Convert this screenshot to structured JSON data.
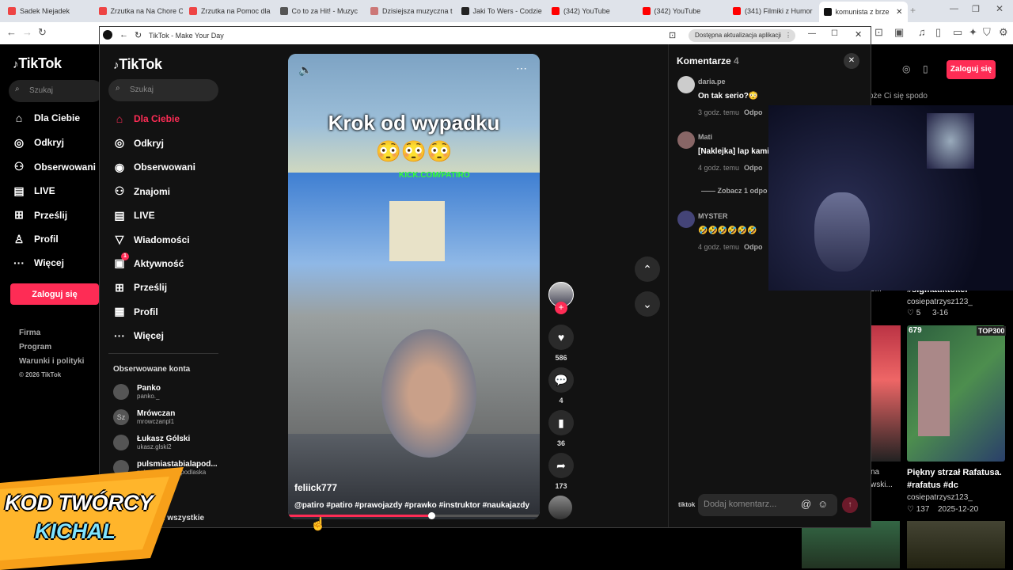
{
  "browser_tabs": [
    {
      "label": "Sadek Niejadek",
      "color": "#e44"
    },
    {
      "label": "Zrzutka na Na Chore C",
      "color": "#e44"
    },
    {
      "label": "Zrzutka na Pomoc dla",
      "color": "#e44"
    },
    {
      "label": "Co to za Hit! - Muzyc",
      "color": "#555"
    },
    {
      "label": "Dzisiejsza muzyczna t",
      "color": "#c77"
    },
    {
      "label": "Jaki To Wers - Codzie",
      "color": "#222"
    },
    {
      "label": "(342) YouTube",
      "color": "#f00"
    },
    {
      "label": "(342) YouTube",
      "color": "#f00"
    },
    {
      "label": "(341) Filmiki z Humor",
      "color": "#f00"
    },
    {
      "label": "komunista z brze",
      "color": "#111"
    }
  ],
  "bg": {
    "logo": "TikTok",
    "search_placeholder": "Szukaj",
    "nav": [
      {
        "icon": "⌂",
        "label": "Dla Ciebie"
      },
      {
        "icon": "◎",
        "label": "Odkryj"
      },
      {
        "icon": "⚇",
        "label": "Obserwowani"
      },
      {
        "icon": "▤",
        "label": "LIVE"
      },
      {
        "icon": "⊞",
        "label": "Prześlij"
      },
      {
        "icon": "♙",
        "label": "Profil"
      },
      {
        "icon": "···",
        "label": "Więcej"
      }
    ],
    "login": "Zaloguj się",
    "footer": [
      "Firma",
      "Program",
      "Warunki i polityki",
      "© 2026 TikTok"
    ],
    "top_login": "Zaloguj się",
    "suggest_text": "oże Ci się spodo",
    "cards": [
      {
        "tag": "#sigmatiktoker",
        "author": "cosiepatrzysz123_",
        "likes": "♡ 5",
        "date": "3-16",
        "partial": "o..."
      },
      {
        "title": "Piękny strzał Rafatusa.",
        "tags": "#rafatus #dc",
        "author": "cosiepatrzysz123_",
        "likes": "♡ 137",
        "date": "2025-12-20",
        "partial_a": "na",
        "partial_b": "wski..."
      }
    ],
    "card_badge": "679",
    "card_badge2": "TOP300"
  },
  "win": {
    "title": "TikTok - Make Your Day",
    "update": "Dostępna aktualizacja aplikacji",
    "logo": "TikTok",
    "search_placeholder": "Szukaj",
    "nav": [
      {
        "icon": "⌂",
        "label": "Dla Ciebie",
        "active": true
      },
      {
        "icon": "◎",
        "label": "Odkryj"
      },
      {
        "icon": "◉",
        "label": "Obserwowani"
      },
      {
        "icon": "⚇",
        "label": "Znajomi"
      },
      {
        "icon": "▤",
        "label": "LIVE"
      },
      {
        "icon": "▽",
        "label": "Wiadomości"
      },
      {
        "icon": "▣",
        "label": "Aktywność",
        "badge": "1"
      },
      {
        "icon": "⊞",
        "label": "Prześlij"
      },
      {
        "icon": "tiktok",
        "label": "Profil"
      },
      {
        "icon": "···",
        "label": "Więcej"
      }
    ],
    "followed_header": "Obserwowane konta",
    "accounts": [
      {
        "name": "Panko",
        "handle": "panko._",
        "av": ""
      },
      {
        "name": "Mrówczan",
        "handle": "mrowczanpl1",
        "av": "Sz"
      },
      {
        "name": "Łukasz Gólski",
        "handle": "ukasz.glski2",
        "av": ""
      },
      {
        "name": "pulsmiastabialapod...",
        "handle": "pulsmiastabialapodlaska",
        "av": ""
      }
    ],
    "see_all": "Wyświetl wszystkie"
  },
  "video": {
    "caption_title": "Krok od wypadku",
    "emojis": "😳😳😳",
    "watermark": "KICK.COM/PATIRO",
    "author": "feliick777",
    "hashtags": "@patiro #patiro #prawojazdy #prawko #instruktor #naukajazdy",
    "progress": 0.57
  },
  "actions": {
    "likes": "586",
    "comments": "4",
    "saves": "36",
    "shares": "173"
  },
  "comments": {
    "header": "Komentarze",
    "count": "4",
    "items": [
      {
        "user": "daria.pe",
        "text": "On tak serio?😳",
        "time": "3 godz. temu",
        "reply": "Odpo"
      },
      {
        "user": "Mati",
        "text": "[Naklejka] lap kami",
        "time": "4 godz. temu",
        "reply": "Odpo"
      },
      {
        "user": "MYSTER",
        "text": "🤣🤣🤣🤣🤣🤣",
        "time": "4 godz. temu",
        "reply": "Odpo"
      }
    ],
    "see_replies": "Zobacz 1 odpo",
    "input_placeholder": "Dodaj komentarz...",
    "tiktok_small": "tiktok"
  },
  "overlay": {
    "line1": "KOD TWÓRCY",
    "line2": "KICHAL"
  }
}
